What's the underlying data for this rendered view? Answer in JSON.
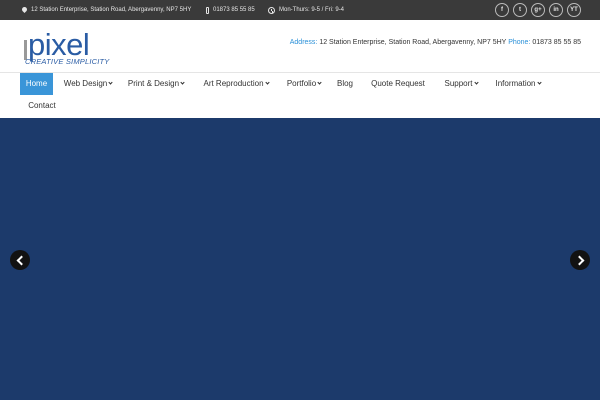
{
  "topbar": {
    "address": "12 Station Enterprise, Station Road, Abergavenny, NP7 5HY",
    "phone": "01873 85 55 85",
    "hours": "Mon-Thurs: 9-5 / Fri: 9-4",
    "social": [
      {
        "icon": "facebook-icon",
        "glyph": "f"
      },
      {
        "icon": "twitter-icon",
        "glyph": "t"
      },
      {
        "icon": "google-plus-icon",
        "glyph": "g+"
      },
      {
        "icon": "linkedin-icon",
        "glyph": "in"
      },
      {
        "icon": "youtube-icon",
        "glyph": "YT"
      }
    ]
  },
  "header": {
    "logo_word": "pixel",
    "logo_tagline": "CREATIVE SIMPLICITY",
    "address_label": "Address:",
    "address_value": "12 Station Enterprise, Station Road, Abergavenny, NP7 5HY",
    "phone_label": "Phone:",
    "phone_value": "01873 85 55 85"
  },
  "nav": {
    "items": [
      {
        "label": "Home",
        "active": true
      },
      {
        "label": "Web Design",
        "dropdown": true
      },
      {
        "label": "Print & Design",
        "dropdown": true
      },
      {
        "label": "Art Reproduction",
        "dropdown": true
      },
      {
        "label": "Portfolio",
        "dropdown": true
      },
      {
        "label": "Blog"
      },
      {
        "label": "Quote Request"
      },
      {
        "label": "Support",
        "dropdown": true
      },
      {
        "label": "Information",
        "dropdown": true
      },
      {
        "label": "Contact"
      }
    ]
  },
  "hero": {
    "background_color": "#1c3a6b"
  },
  "colors": {
    "accent": "#3a95d8",
    "brand": "#2a5ca4",
    "topbar": "#3a3a3a"
  }
}
